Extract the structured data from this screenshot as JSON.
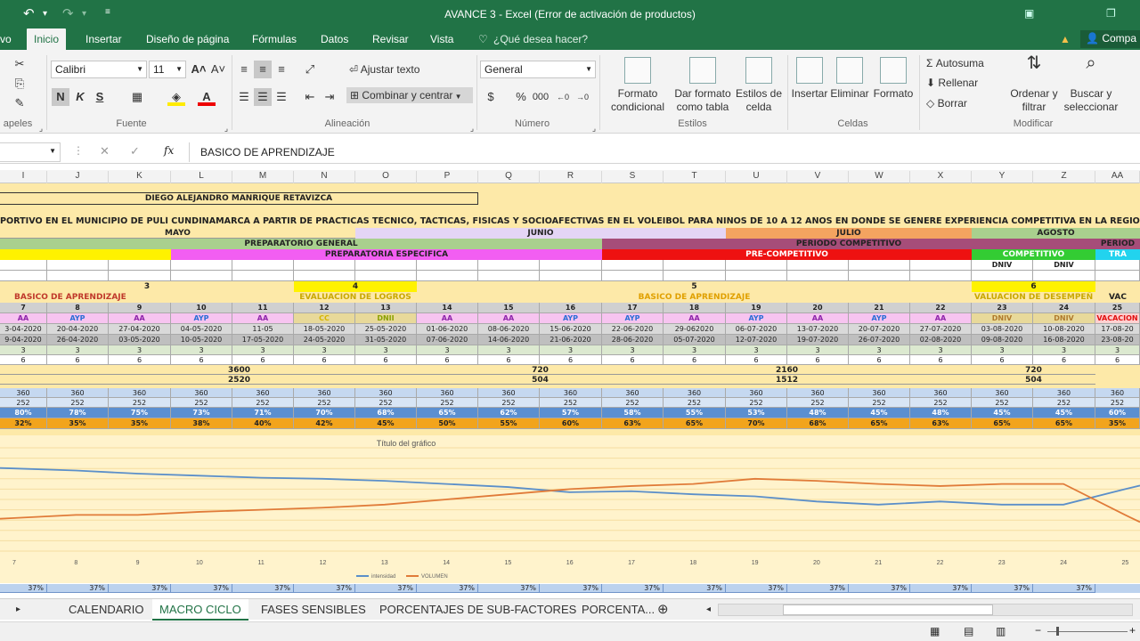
{
  "title": "AVANCE 3 - Excel (Error de activación de productos)",
  "ribbon_tabs": [
    "vo",
    "Inicio",
    "Insertar",
    "Diseño de página",
    "Fórmulas",
    "Datos",
    "Revisar",
    "Vista"
  ],
  "tell_me": "¿Qué desea hacer?",
  "share": "Compa",
  "font_name": "Calibri",
  "font_size": "11",
  "wrap_text": "Ajustar texto",
  "merge_center": "Combinar y centrar",
  "number_format": "General",
  "groups": {
    "clipboard": "apeles",
    "font": "Fuente",
    "alignment": "Alineación",
    "number": "Número",
    "styles": "Estilos",
    "cells": "Celdas",
    "editing": "Modificar"
  },
  "buttons": {
    "cond_format": [
      "Formato",
      "condicional"
    ],
    "table_format": [
      "Dar formato",
      "como tabla"
    ],
    "cell_styles": [
      "Estilos de",
      "celda"
    ],
    "insert": "Insertar",
    "delete": "Eliminar",
    "format": "Formato",
    "autosum": "Autosuma",
    "fill": "Rellenar",
    "clear": "Borrar",
    "sort_filter": [
      "Ordenar y",
      "filtrar"
    ],
    "find_select": [
      "Buscar y",
      "seleccionar"
    ]
  },
  "formula": "BASICO DE APRENDIZAJE",
  "columns": [
    "I",
    "J",
    "K",
    "L",
    "M",
    "N",
    "O",
    "P",
    "Q",
    "R",
    "S",
    "T",
    "U",
    "V",
    "W",
    "X",
    "Y",
    "Z",
    "AA"
  ],
  "sheet": {
    "author": "DIEGO ALEJANDRO MANRIQUE RETAVIZCA",
    "long_title": "PORTIVO EN EL MUNICIPIO DE PULÍ CUNDINAMARCA A PARTIR DE PRÁCTICAS TÉCNICO, TÁCTICAS, FÍSICAS Y SOCIOAFECTIVAS EN EL VOLEIBOL PARA NIÑOS DE 10 A 12 AÑOS EN DONDE SE GENERE EXPERIENCIA COMPETITIVA EN LA REGIÓ",
    "months": [
      "MAYO",
      "JUNIO",
      "JULIO",
      "AGOSTO"
    ],
    "periods": [
      "PREPARATORIO GENERAL",
      "PERIODO COMPETITIVO",
      "PERIOD"
    ],
    "stages": [
      "PREPARATORIA ESPECIFICA",
      "PRE-COMPETITIVO",
      "COMPETITIVO",
      "TRA"
    ],
    "dniv": [
      "DNIV",
      "DNIV"
    ],
    "meso": [
      "3",
      "4",
      "5",
      "6"
    ],
    "meso_names": [
      "BASICO DE APRENDIZAJE",
      "EVALUACION DE LOGROS",
      "BASICO DE APRENDIZAJE",
      "VALUACION DE DESEMPEÑ",
      "VAC"
    ],
    "weeks": [
      "7",
      "8",
      "9",
      "10",
      "11",
      "12",
      "13",
      "14",
      "15",
      "16",
      "17",
      "18",
      "19",
      "20",
      "21",
      "22",
      "23",
      "24",
      "25"
    ],
    "types": [
      "AA",
      "AYP",
      "AA",
      "AYP",
      "AA",
      "CC",
      "DNII",
      "AA",
      "AA",
      "AYP",
      "AYP",
      "AA",
      "AYP",
      "AA",
      "AYP",
      "AA",
      "DNIV",
      "DNIV",
      "VACACION"
    ],
    "start_dates": [
      "3-04-2020",
      "20-04-2020",
      "27-04-2020",
      "04-05-2020",
      "11-05",
      "18-05-2020",
      "25-05-2020",
      "01-06-2020",
      "08-06-2020",
      "15-06-2020",
      "22-06-2020",
      "29-062020",
      "06-07-2020",
      "13-07-2020",
      "20-07-2020",
      "27-07-2020",
      "03-08-2020",
      "10-08-2020",
      "17-08-20"
    ],
    "end_dates": [
      "9-04-2020",
      "26-04-2020",
      "03-05-2020",
      "10-05-2020",
      "17-05-2020",
      "24-05-2020",
      "31-05-2020",
      "07-06-2020",
      "14-06-2020",
      "21-06-2020",
      "28-06-2020",
      "05-07-2020",
      "12-07-2020",
      "19-07-2020",
      "26-07-2020",
      "02-08-2020",
      "09-08-2020",
      "16-08-2020",
      "23-08-20"
    ],
    "sessions": "3",
    "hours": "6",
    "block_totals": [
      "3600",
      "720",
      "2160",
      "720"
    ],
    "block_subtotals": [
      "2520",
      "504",
      "1512",
      "504"
    ],
    "minutes": "360",
    "minutes2": "252",
    "intensity": [
      "80%",
      "78%",
      "75%",
      "73%",
      "71%",
      "70%",
      "68%",
      "65%",
      "62%",
      "57%",
      "58%",
      "55%",
      "53%",
      "48%",
      "45%",
      "48%",
      "45%",
      "45%",
      "60%"
    ],
    "volume": [
      "32%",
      "35%",
      "35%",
      "38%",
      "40%",
      "42%",
      "45%",
      "50%",
      "55%",
      "60%",
      "63%",
      "65%",
      "70%",
      "68%",
      "65%",
      "63%",
      "65%",
      "65%",
      "35%"
    ],
    "footer_pct": "37%"
  },
  "chart_data": {
    "type": "line",
    "title": "Título del gráfico",
    "categories": [
      "7",
      "8",
      "9",
      "10",
      "11",
      "12",
      "13",
      "14",
      "15",
      "16",
      "17",
      "18",
      "19",
      "20",
      "21",
      "22",
      "23",
      "24",
      "25"
    ],
    "series": [
      {
        "name": "intensidad",
        "color": "#5b8fc9",
        "values": [
          80,
          78,
          75,
          73,
          71,
          70,
          68,
          65,
          62,
          57,
          58,
          55,
          53,
          48,
          45,
          48,
          45,
          45,
          60
        ]
      },
      {
        "name": "VOLUMEN",
        "color": "#e07b39",
        "values": [
          32,
          35,
          35,
          38,
          40,
          42,
          45,
          50,
          55,
          60,
          63,
          65,
          70,
          68,
          65,
          63,
          65,
          65,
          35
        ]
      }
    ],
    "ylim": [
      0,
      100
    ],
    "grid": true,
    "legend": "bottom"
  },
  "sheet_tabs": [
    "CALENDARIO",
    "MACRO CICLO",
    "FASES SENSIBLES",
    "PORCENTAJES DE SUB-FACTORES",
    "PORCENTA..."
  ],
  "colors": {
    "excel_green": "#217346",
    "sheet_bg": "#fde9a8",
    "magenta": "#f25ef2",
    "red": "#ee1111",
    "yellow": "#fff200",
    "green_light": "#a9d08e",
    "orange": "#f4a460",
    "purple": "#a64d79"
  }
}
